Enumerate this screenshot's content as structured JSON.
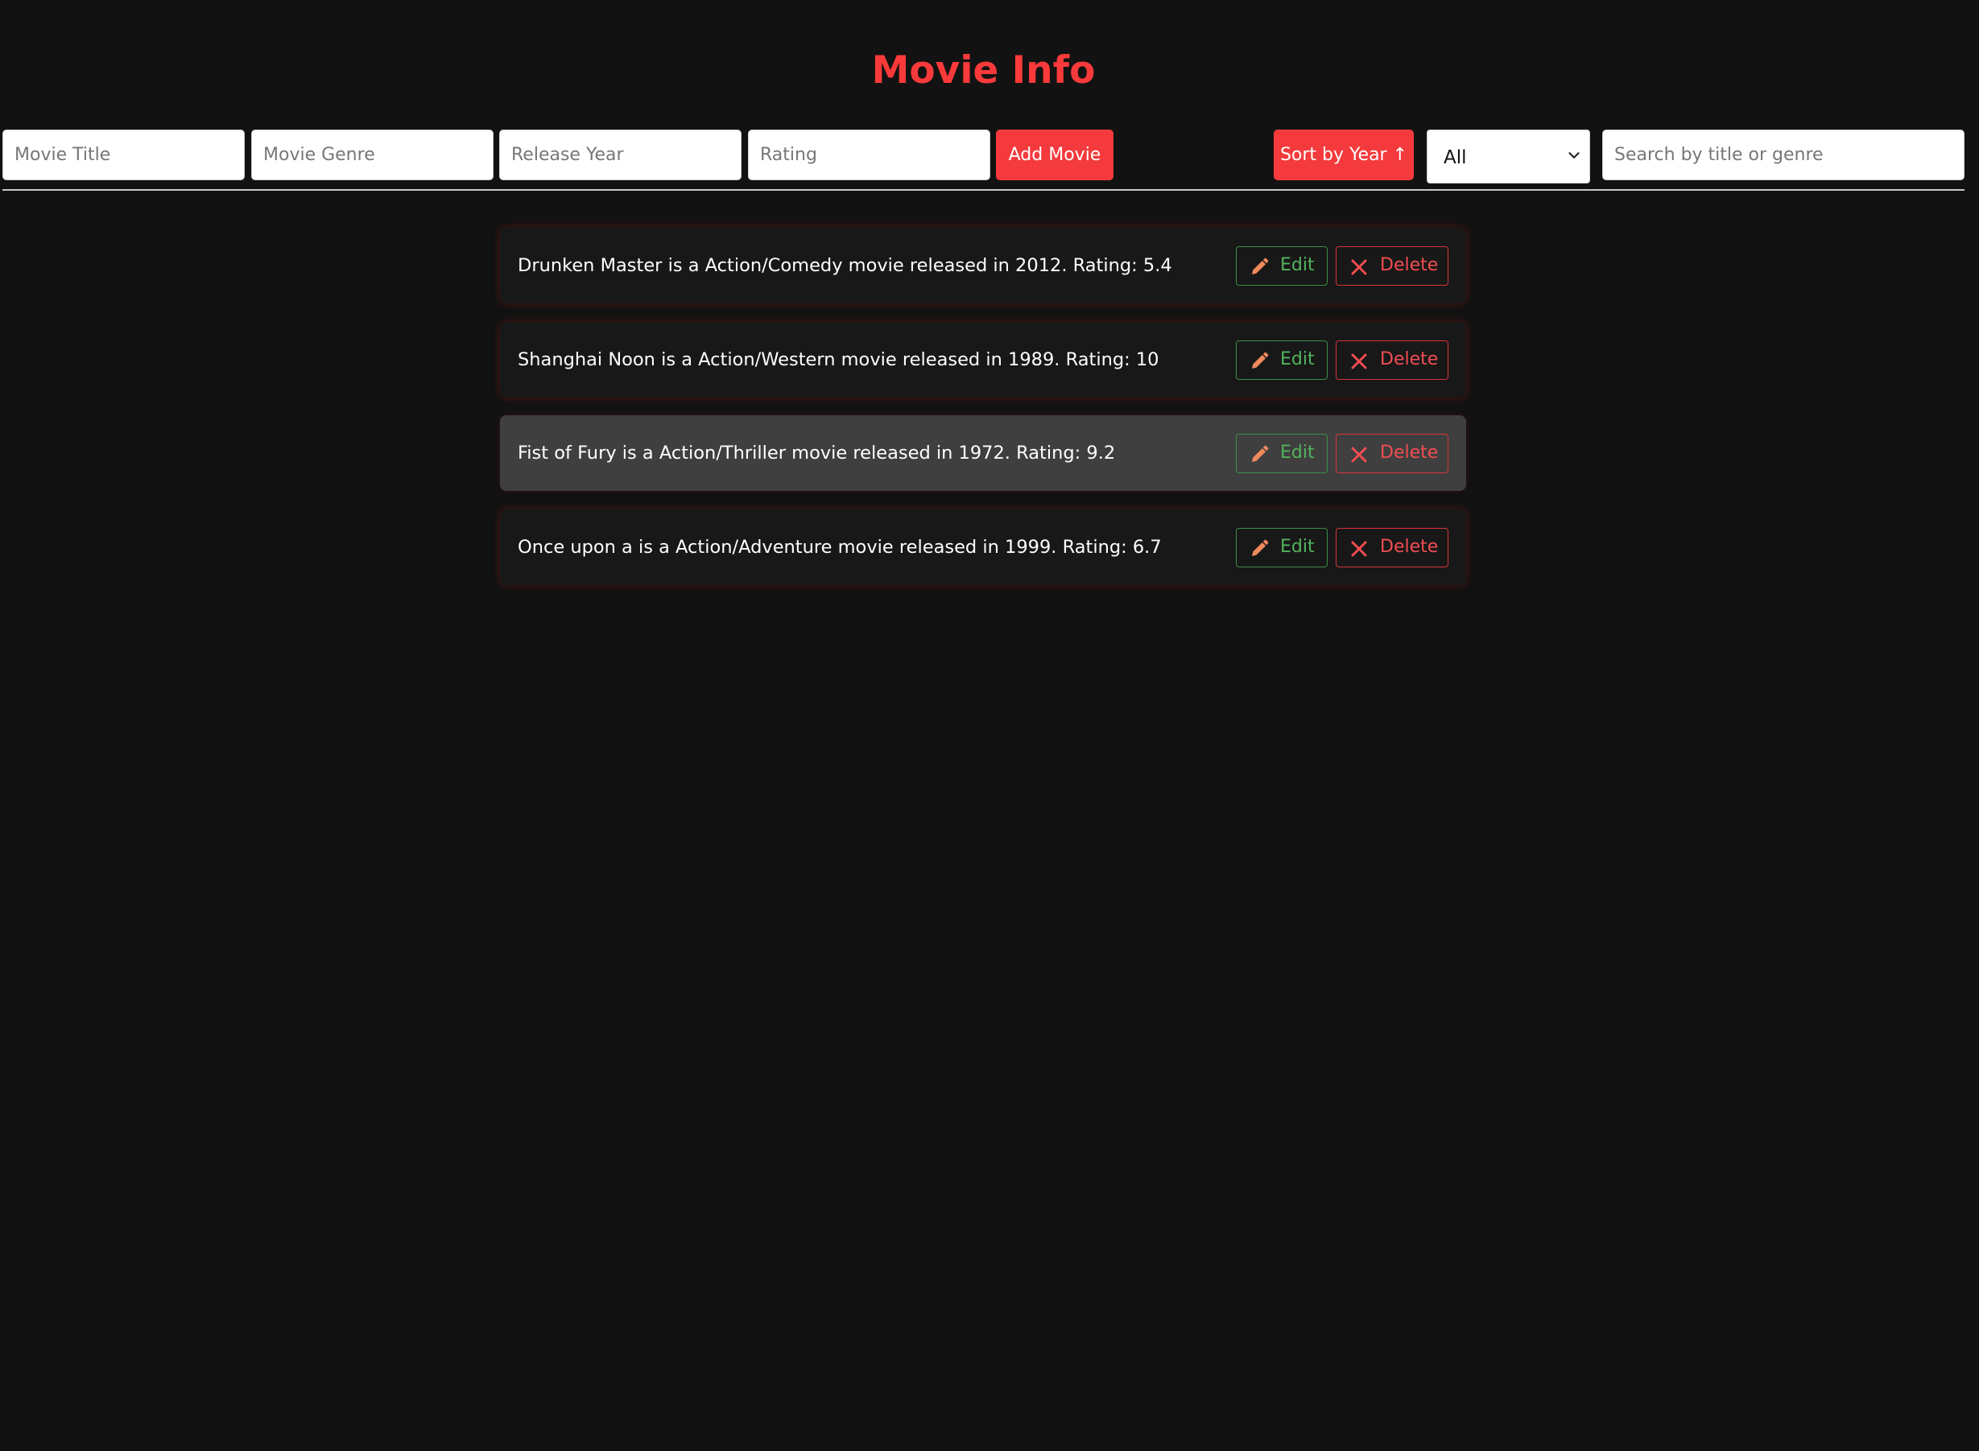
{
  "app": {
    "title": "Movie Info"
  },
  "toolbar": {
    "title_placeholder": "Movie Title",
    "genre_placeholder": "Movie Genre",
    "year_placeholder": "Release Year",
    "rating_placeholder": "Rating",
    "add_label": "Add Movie",
    "sort_label": "Sort by Year ↑",
    "filter_value": "All",
    "search_placeholder": "Search by title or genre"
  },
  "colors": {
    "accent": "#f43a3c",
    "background": "#121212",
    "edit": "#52b35c",
    "delete": "#f24d52"
  },
  "icons": {
    "edit": "pencil-icon",
    "delete": "close-icon",
    "filter": "chevron-down-icon"
  },
  "movies": [
    {
      "text": "Drunken Master is a Action/Comedy movie released in 2012. Rating: 5.4",
      "edit_label": "Edit",
      "delete_label": "Delete"
    },
    {
      "text": "Shanghai Noon is a Action/Western movie released in 1989. Rating: 10",
      "edit_label": "Edit",
      "delete_label": "Delete"
    },
    {
      "text": "Fist of Fury is a Action/Thriller movie released in 1972. Rating: 9.2",
      "edit_label": "Edit",
      "delete_label": "Delete"
    },
    {
      "text": "Once upon a is a Action/Adventure movie released in 1999. Rating: 6.7",
      "edit_label": "Edit",
      "delete_label": "Delete"
    }
  ]
}
